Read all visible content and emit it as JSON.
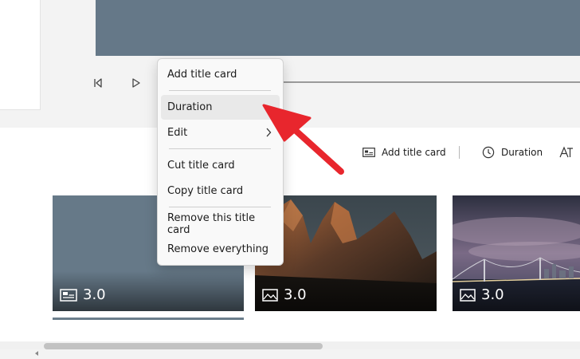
{
  "menu": {
    "items": [
      {
        "label": "Add title card",
        "highlighted": false
      },
      {
        "label": "Duration",
        "highlighted": true
      },
      {
        "label": "Edit",
        "submenu": true
      },
      {
        "label": "Cut title card"
      },
      {
        "label": "Copy title card"
      },
      {
        "label": "Remove this title card"
      },
      {
        "label": "Remove everything"
      }
    ]
  },
  "toolbar": {
    "add_title_card": "Add title card",
    "duration": "Duration"
  },
  "cards": [
    {
      "type": "title-card",
      "duration": "3.0"
    },
    {
      "type": "image",
      "scene": "mountain peaks",
      "duration": "3.0"
    },
    {
      "type": "image",
      "scene": "bridge at night",
      "duration": "3.0"
    }
  ],
  "colors": {
    "accent_arrow": "#e8262d",
    "title_card_bg": "#667988",
    "preview_bg": "#657888"
  }
}
